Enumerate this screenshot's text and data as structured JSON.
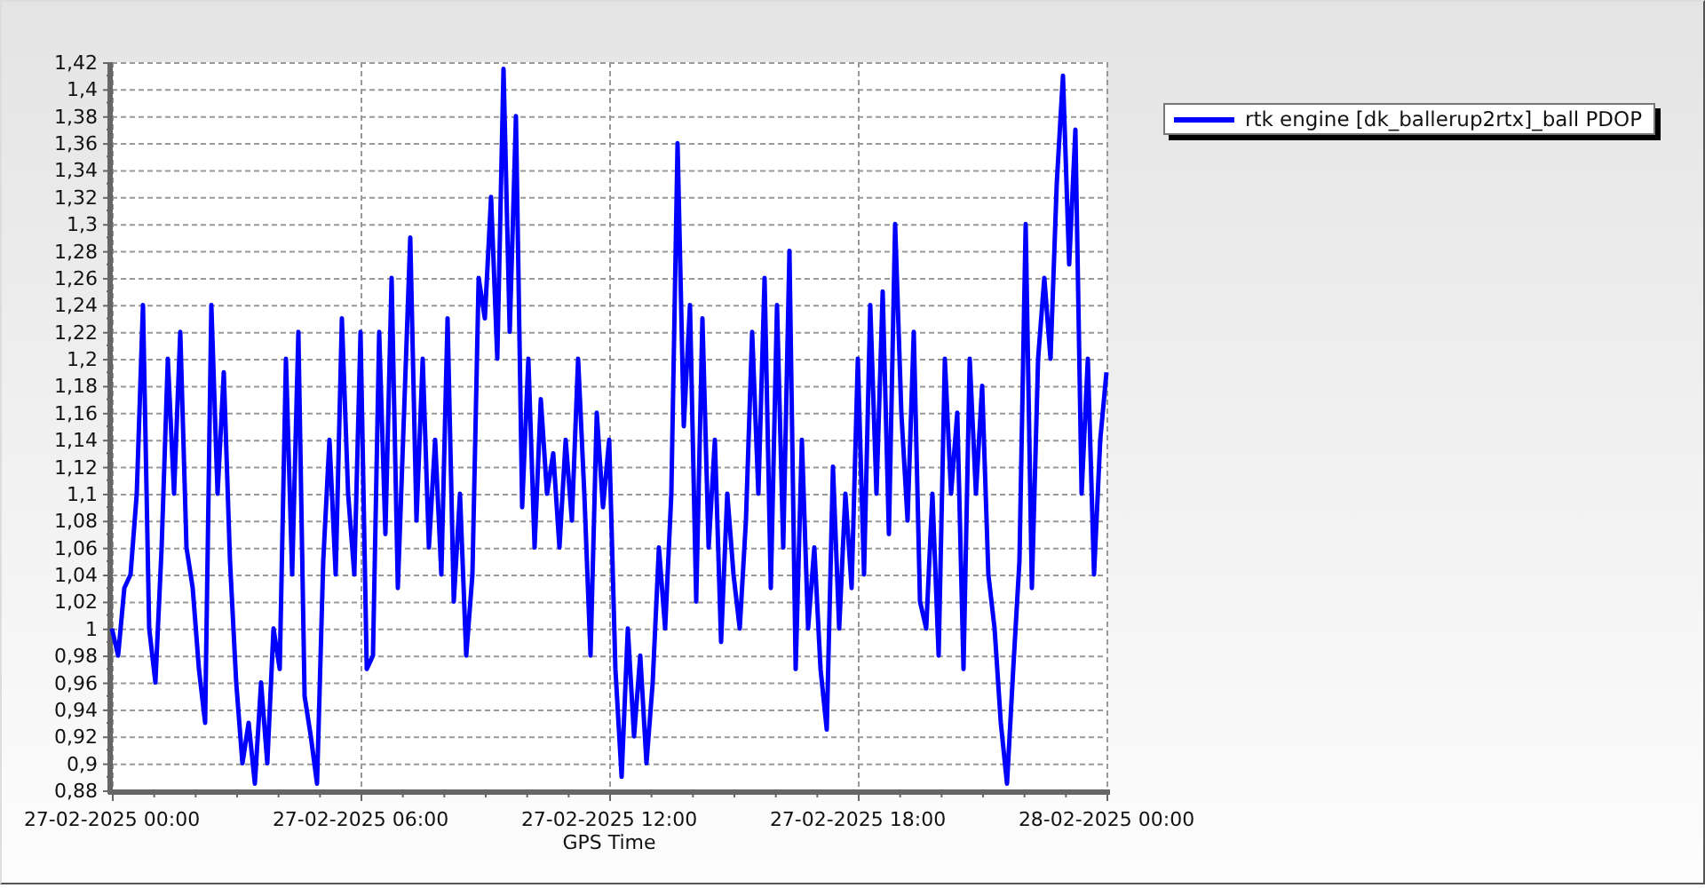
{
  "chart_data": {
    "type": "line",
    "xlabel": "GPS Time",
    "grid": true,
    "ylim": [
      0.88,
      1.42
    ],
    "categories": [
      "27-02-2025 00:00",
      null,
      null,
      null,
      null,
      null,
      null,
      null,
      null,
      null,
      null,
      null,
      null,
      null,
      null,
      null,
      null,
      null,
      null,
      null,
      null,
      null,
      null,
      null,
      null,
      null,
      null,
      null,
      null,
      null,
      null,
      null,
      null,
      null,
      null,
      null,
      null,
      null,
      null,
      null,
      "27-02-2025 06:00",
      null,
      null,
      null,
      null,
      null,
      null,
      null,
      null,
      null,
      null,
      null,
      null,
      null,
      null,
      null,
      null,
      null,
      null,
      null,
      null,
      null,
      null,
      null,
      null,
      null,
      null,
      null,
      null,
      null,
      null,
      null,
      null,
      null,
      null,
      null,
      null,
      null,
      null,
      null,
      "27-02-2025 12:00",
      null,
      null,
      null,
      null,
      null,
      null,
      null,
      null,
      null,
      null,
      null,
      null,
      null,
      null,
      null,
      null,
      null,
      null,
      null,
      null,
      null,
      null,
      null,
      null,
      null,
      null,
      null,
      null,
      null,
      null,
      null,
      null,
      null,
      null,
      null,
      null,
      null,
      null,
      null,
      "27-02-2025 18:00",
      null,
      null,
      null,
      null,
      null,
      null,
      null,
      null,
      null,
      null,
      null,
      null,
      null,
      null,
      null,
      null,
      null,
      null,
      null,
      null,
      null,
      null,
      null,
      null,
      null,
      null,
      null,
      null,
      null,
      null,
      null,
      null,
      null,
      null,
      null,
      null,
      null,
      null,
      null,
      "28-02-2025 00:00"
    ],
    "yticks": [
      {
        "value": 0.88,
        "label": "0,88"
      },
      {
        "value": 0.9,
        "label": "0,9"
      },
      {
        "value": 0.92,
        "label": "0,92"
      },
      {
        "value": 0.94,
        "label": "0,94"
      },
      {
        "value": 0.96,
        "label": "0,96"
      },
      {
        "value": 0.98,
        "label": "0,98"
      },
      {
        "value": 1,
        "label": "1"
      },
      {
        "value": 1.02,
        "label": "1,02"
      },
      {
        "value": 1.04,
        "label": "1,04"
      },
      {
        "value": 1.06,
        "label": "1,06"
      },
      {
        "value": 1.08,
        "label": "1,08"
      },
      {
        "value": 1.1,
        "label": "1,1"
      },
      {
        "value": 1.12,
        "label": "1,12"
      },
      {
        "value": 1.14,
        "label": "1,14"
      },
      {
        "value": 1.16,
        "label": "1,16"
      },
      {
        "value": 1.18,
        "label": "1,18"
      },
      {
        "value": 1.2,
        "label": "1,2"
      },
      {
        "value": 1.22,
        "label": "1,22"
      },
      {
        "value": 1.24,
        "label": "1,24"
      },
      {
        "value": 1.26,
        "label": "1,26"
      },
      {
        "value": 1.28,
        "label": "1,28"
      },
      {
        "value": 1.3,
        "label": "1,3"
      },
      {
        "value": 1.32,
        "label": "1,32"
      },
      {
        "value": 1.34,
        "label": "1,34"
      },
      {
        "value": 1.36,
        "label": "1,36"
      },
      {
        "value": 1.38,
        "label": "1,38"
      },
      {
        "value": 1.4,
        "label": "1,4"
      },
      {
        "value": 1.42,
        "label": "1,42"
      }
    ],
    "series": [
      {
        "name": "rtk engine [dk_ballerup2rtx]_ball PDOP",
        "color": "#0000ff",
        "values": [
          1.0,
          0.98,
          1.03,
          1.04,
          1.1,
          1.24,
          1.0,
          0.96,
          1.06,
          1.2,
          1.1,
          1.22,
          1.06,
          1.03,
          0.97,
          0.93,
          1.24,
          1.1,
          1.19,
          1.05,
          0.96,
          0.9,
          0.93,
          0.885,
          0.96,
          0.9,
          1.0,
          0.97,
          1.2,
          1.04,
          1.22,
          0.95,
          0.92,
          0.885,
          1.05,
          1.14,
          1.04,
          1.23,
          1.1,
          1.04,
          1.22,
          0.97,
          0.98,
          1.22,
          1.07,
          1.26,
          1.03,
          1.16,
          1.29,
          1.08,
          1.2,
          1.06,
          1.14,
          1.04,
          1.23,
          1.02,
          1.1,
          0.98,
          1.04,
          1.26,
          1.23,
          1.32,
          1.2,
          1.415,
          1.22,
          1.38,
          1.09,
          1.2,
          1.06,
          1.17,
          1.1,
          1.13,
          1.06,
          1.14,
          1.08,
          1.2,
          1.1,
          0.98,
          1.16,
          1.09,
          1.14,
          0.97,
          0.89,
          1.0,
          0.92,
          0.98,
          0.9,
          0.96,
          1.06,
          1.0,
          1.1,
          1.36,
          1.15,
          1.24,
          1.02,
          1.23,
          1.06,
          1.14,
          0.99,
          1.1,
          1.04,
          1.0,
          1.08,
          1.22,
          1.1,
          1.26,
          1.03,
          1.24,
          1.06,
          1.28,
          0.97,
          1.14,
          1.0,
          1.06,
          0.97,
          0.925,
          1.12,
          1.0,
          1.1,
          1.03,
          1.2,
          1.04,
          1.24,
          1.1,
          1.25,
          1.07,
          1.3,
          1.16,
          1.08,
          1.22,
          1.02,
          1.0,
          1.1,
          0.98,
          1.2,
          1.1,
          1.16,
          0.97,
          1.2,
          1.1,
          1.18,
          1.04,
          1.0,
          0.93,
          0.885,
          0.97,
          1.05,
          1.3,
          1.03,
          1.2,
          1.26,
          1.2,
          1.33,
          1.41,
          1.27,
          1.37,
          1.1,
          1.2,
          1.04,
          1.14,
          1.19
        ]
      }
    ]
  }
}
